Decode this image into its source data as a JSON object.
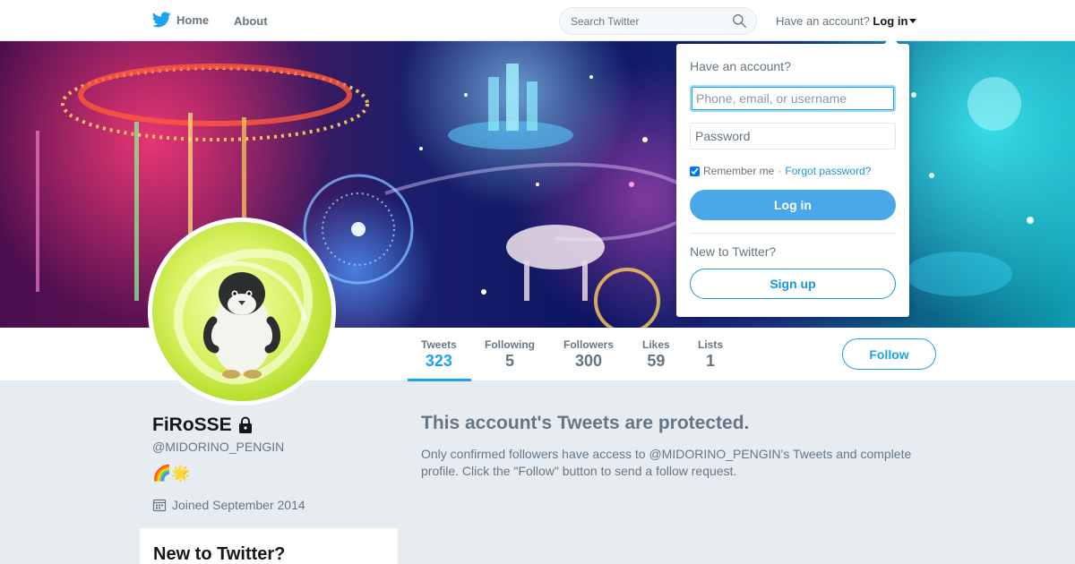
{
  "nav": {
    "home_label": "Home",
    "about_label": "About",
    "search_placeholder": "Search Twitter",
    "account_prompt": "Have an account?",
    "login_label": "Log in"
  },
  "profile": {
    "name": "FiRoSSE",
    "handle": "@MIDORINO_PENGIN",
    "bio": "🌈🌟",
    "joined": "Joined September 2014"
  },
  "stats": [
    {
      "label": "Tweets",
      "value": "323"
    },
    {
      "label": "Following",
      "value": "5"
    },
    {
      "label": "Followers",
      "value": "300"
    },
    {
      "label": "Likes",
      "value": "59"
    },
    {
      "label": "Lists",
      "value": "1"
    }
  ],
  "follow_label": "Follow",
  "protected": {
    "title": "This account's Tweets are protected.",
    "body": "Only confirmed followers have access to @MIDORINO_PENGIN's Tweets and complete profile. Click the \"Follow\" button to send a follow request."
  },
  "sidebar": {
    "new_title": "New to Twitter?"
  },
  "login_dropdown": {
    "heading": "Have an account?",
    "username_placeholder": "Phone, email, or username",
    "password_placeholder": "Password",
    "remember_label": "Remember me",
    "separator": "·",
    "forgot_label": "Forgot password?",
    "login_button": "Log in",
    "new_prompt": "New to Twitter?",
    "signup_button": "Sign up"
  },
  "colors": {
    "accent": "#1da1f2",
    "login_button": "#4aa8e8",
    "background": "#e6ecf0"
  }
}
